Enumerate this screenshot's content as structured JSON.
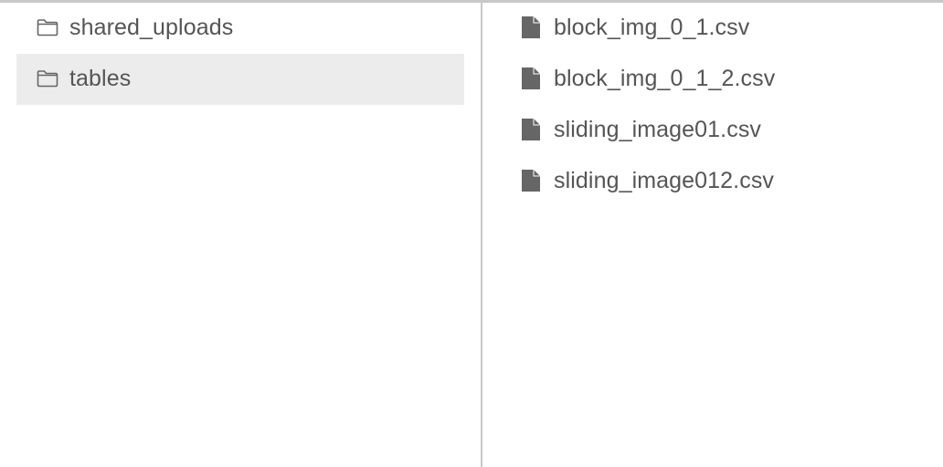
{
  "folders": [
    {
      "name": "shared_uploads",
      "selected": false,
      "icon": "folder-icon"
    },
    {
      "name": "tables",
      "selected": true,
      "icon": "folder-icon"
    }
  ],
  "files": [
    {
      "name": "block_img_0_1.csv",
      "icon": "file-icon"
    },
    {
      "name": "block_img_0_1_2.csv",
      "icon": "file-icon"
    },
    {
      "name": "sliding_image01.csv",
      "icon": "file-icon"
    },
    {
      "name": "sliding_image012.csv",
      "icon": "file-icon"
    }
  ],
  "colors": {
    "text": "#555555",
    "icon": "#666666",
    "selected_background": "#ececec",
    "divider": "#c8c8c8"
  }
}
